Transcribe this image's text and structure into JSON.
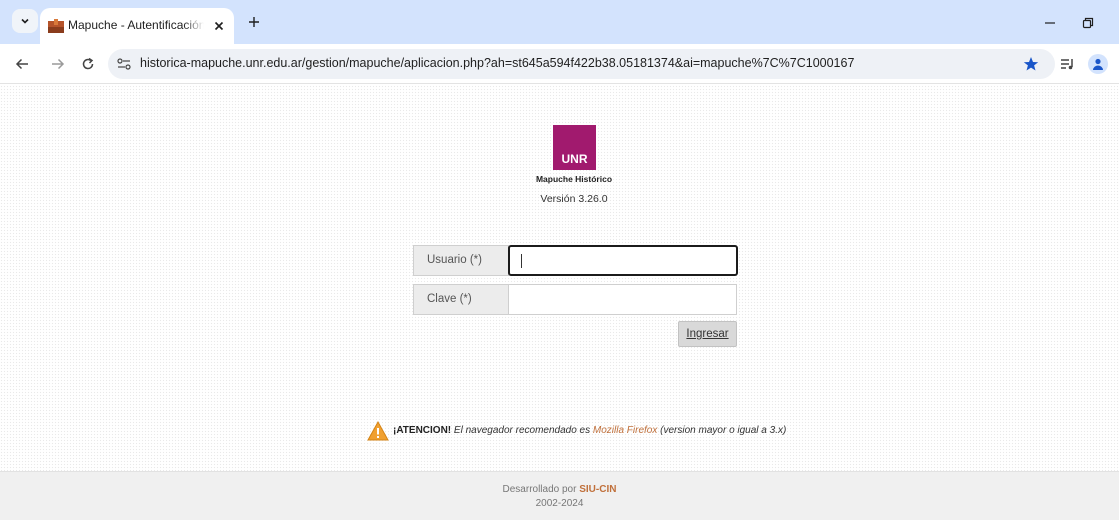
{
  "browser": {
    "tab_title": "Mapuche - Autentificación de Usuario",
    "url": "historica-mapuche.unr.edu.ar/gestion/mapuche/aplicacion.php?ah=st645a594f422b38.05181374&ai=mapuche%7C%7C1000167"
  },
  "header": {
    "logo_text": "UNR",
    "app_name": "Mapuche Histórico",
    "version": "Versión 3.26.0"
  },
  "login": {
    "user_label": "Usuario (*)",
    "user_value": "",
    "password_label": "Clave (*)",
    "password_value": "",
    "submit_label": "Ingresar"
  },
  "notice": {
    "prefix": "¡ATENCION!",
    "text_before": "El navegador recomendado es",
    "browser_name": "Mozilla Firefox",
    "text_after": "(version mayor o igual a 3.x)"
  },
  "footer": {
    "developed_by": "Desarrollado por",
    "developer": "SIU-CIN",
    "years": "2002-2024"
  },
  "colors": {
    "logo_bg": "#a11a6e",
    "link": "#c0703b",
    "tabstrip": "#d3e3fd"
  }
}
